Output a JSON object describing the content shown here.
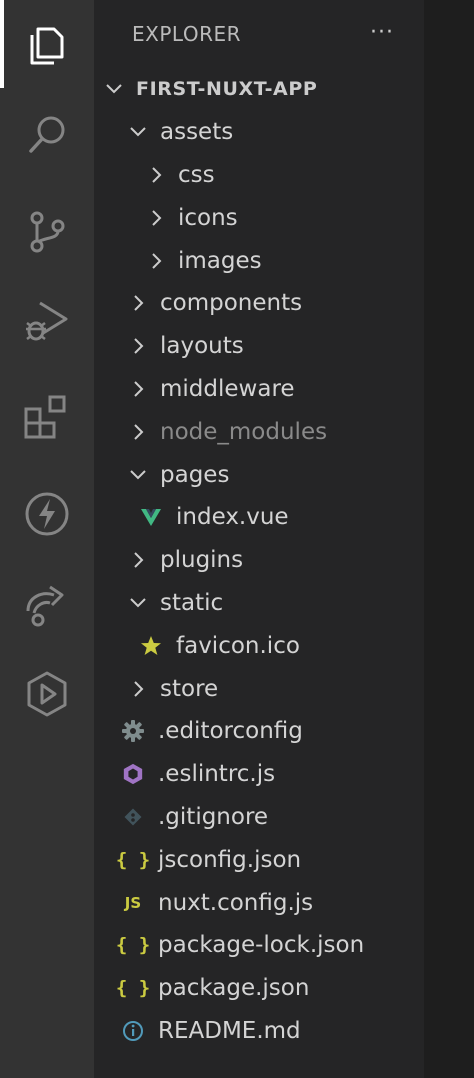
{
  "activity_bar": {
    "items": [
      {
        "name": "explorer-icon"
      },
      {
        "name": "search-icon"
      },
      {
        "name": "source-control-icon"
      },
      {
        "name": "run-debug-icon"
      },
      {
        "name": "extensions-icon"
      },
      {
        "name": "lightning-icon"
      },
      {
        "name": "remote-explorer-icon"
      },
      {
        "name": "playground-icon"
      }
    ],
    "active_index": 0
  },
  "explorer": {
    "title": "EXPLORER",
    "more_actions": "···",
    "root": "FIRST-NUXT-APP",
    "tree": [
      {
        "label": "assets",
        "type": "folder",
        "expanded": true,
        "depth": 1
      },
      {
        "label": "css",
        "type": "folder",
        "expanded": false,
        "depth": 2
      },
      {
        "label": "icons",
        "type": "folder",
        "expanded": false,
        "depth": 2
      },
      {
        "label": "images",
        "type": "folder",
        "expanded": false,
        "depth": 2
      },
      {
        "label": "components",
        "type": "folder",
        "expanded": false,
        "depth": 1
      },
      {
        "label": "layouts",
        "type": "folder",
        "expanded": false,
        "depth": 1
      },
      {
        "label": "middleware",
        "type": "folder",
        "expanded": false,
        "depth": 1
      },
      {
        "label": "node_modules",
        "type": "folder",
        "expanded": false,
        "depth": 1,
        "dim": true
      },
      {
        "label": "pages",
        "type": "folder",
        "expanded": true,
        "depth": 1
      },
      {
        "label": "index.vue",
        "type": "file",
        "icon": "vue-icon",
        "depth": 2
      },
      {
        "label": "plugins",
        "type": "folder",
        "expanded": false,
        "depth": 1
      },
      {
        "label": "static",
        "type": "folder",
        "expanded": true,
        "depth": 1
      },
      {
        "label": "favicon.ico",
        "type": "file",
        "icon": "star-icon",
        "depth": 2
      },
      {
        "label": "store",
        "type": "folder",
        "expanded": false,
        "depth": 1
      },
      {
        "label": ".editorconfig",
        "type": "file",
        "icon": "gear-icon",
        "depth": 1
      },
      {
        "label": ".eslintrc.js",
        "type": "file",
        "icon": "eslint-icon",
        "depth": 1
      },
      {
        "label": ".gitignore",
        "type": "file",
        "icon": "git-icon",
        "depth": 1
      },
      {
        "label": "jsconfig.json",
        "type": "file",
        "icon": "json-icon",
        "depth": 1
      },
      {
        "label": "nuxt.config.js",
        "type": "file",
        "icon": "js-icon",
        "depth": 1
      },
      {
        "label": "package-lock.json",
        "type": "file",
        "icon": "json-icon",
        "depth": 1
      },
      {
        "label": "package.json",
        "type": "file",
        "icon": "json-icon",
        "depth": 1
      },
      {
        "label": "README.md",
        "type": "file",
        "icon": "info-icon",
        "depth": 1
      }
    ]
  },
  "colors": {
    "activity_bar_bg": "#333333",
    "sidebar_bg": "#252526",
    "text": "#d4d4d4",
    "vue": "#41b883",
    "json_js": "#cbcb41",
    "star": "#cbcb41",
    "eslint": "#a074c4",
    "info": "#519aba"
  }
}
